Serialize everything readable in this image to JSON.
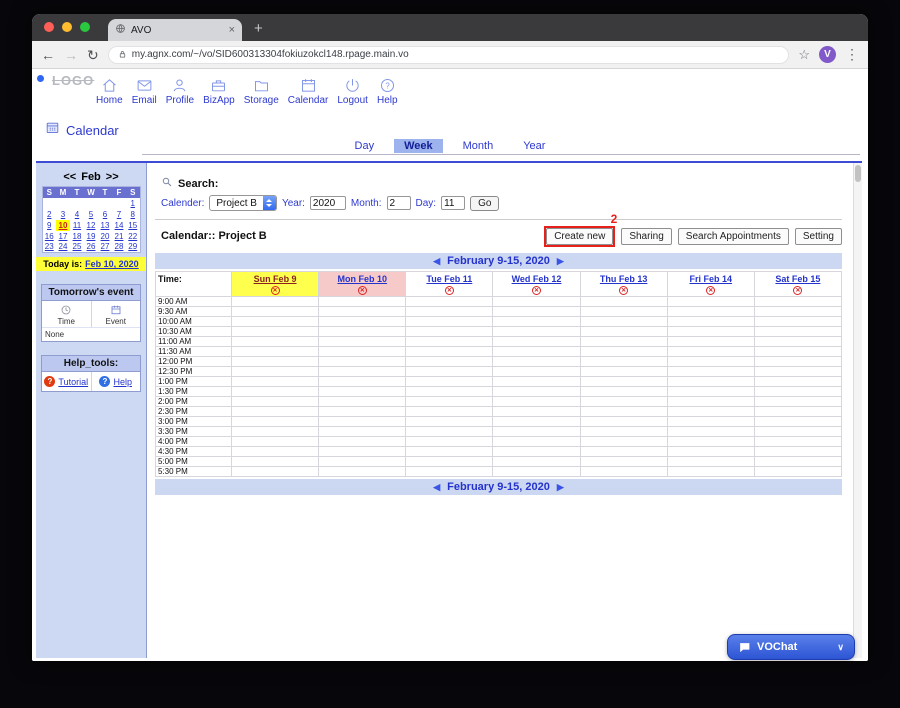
{
  "browser": {
    "tab_title": "AVO",
    "url": "my.agnx.com/~/vo/SID600313304fokiuzokcl148.rpage.main.vo",
    "avatar": "V"
  },
  "icons": {
    "back": "←",
    "forward": "→",
    "reload": "↻",
    "star": "☆",
    "menu": "⋮",
    "tab_close": "×",
    "new_tab": "+",
    "chevron_down": "∨",
    "nav_prev": "◀",
    "nav_next": "▶",
    "delete_x": "✕",
    "question": "?"
  },
  "header": {
    "logo": "LOGO",
    "nav": [
      {
        "label": "Home",
        "icon": "home-icon"
      },
      {
        "label": "Email",
        "icon": "email-icon"
      },
      {
        "label": "Profile",
        "icon": "profile-icon"
      },
      {
        "label": "BizApp",
        "icon": "bizapp-icon"
      },
      {
        "label": "Storage",
        "icon": "storage-icon"
      },
      {
        "label": "Calendar",
        "icon": "calendar-icon"
      },
      {
        "label": "Logout",
        "icon": "logout-icon"
      },
      {
        "label": "Help",
        "icon": "help-icon"
      }
    ],
    "page_title": "Calendar"
  },
  "view_tabs": [
    {
      "label": "Day",
      "active": false
    },
    {
      "label": "Week",
      "active": true
    },
    {
      "label": "Month",
      "active": false
    },
    {
      "label": "Year",
      "active": false
    }
  ],
  "sidebar": {
    "mini_calendar": {
      "prev": "<<",
      "month": "Feb",
      "next": ">>",
      "day_headers": [
        "S",
        "M",
        "T",
        "W",
        "T",
        "F",
        "S"
      ],
      "weeks": [
        [
          "",
          "",
          "",
          "",
          "",
          "",
          "1"
        ],
        [
          "2",
          "3",
          "4",
          "5",
          "6",
          "7",
          "8"
        ],
        [
          "9",
          "10",
          "11",
          "12",
          "13",
          "14",
          "15"
        ],
        [
          "16",
          "17",
          "18",
          "19",
          "20",
          "21",
          "22"
        ],
        [
          "23",
          "24",
          "25",
          "26",
          "27",
          "28",
          "29"
        ]
      ],
      "today": "10"
    },
    "today_label": "Today is:",
    "today_date": "Feb 10, 2020",
    "tomorrow": {
      "title": "Tomorrow's event",
      "col1": "Time",
      "col2": "Event",
      "value": "None"
    },
    "help_tools": {
      "title": "Help_tools:",
      "tutorial": "Tutorial",
      "help": "Help"
    }
  },
  "search": {
    "title": "Search:",
    "calender_label": "Calender:",
    "calender_value": "Project B",
    "year_label": "Year:",
    "year_value": "2020",
    "month_label": "Month:",
    "month_value": "2",
    "day_label": "Day:",
    "day_value": "11",
    "go": "Go"
  },
  "toolbar": {
    "calendar_title": "Calendar:: Project B",
    "buttons": [
      "Create new",
      "Sharing",
      "Search Appointments",
      "Setting"
    ],
    "annotation": "2"
  },
  "week": {
    "nav_label": "February 9-15, 2020",
    "time_header": "Time:",
    "days": [
      {
        "label": "Sun Feb 9",
        "bg": "#ffff4d",
        "color": "#8a2020"
      },
      {
        "label": "Mon Feb 10",
        "bg": "#f7caca",
        "color": "#2433cc"
      },
      {
        "label": "Tue Feb 11",
        "bg": "",
        "color": "#2433cc"
      },
      {
        "label": "Wed Feb 12",
        "bg": "",
        "color": "#2433cc"
      },
      {
        "label": "Thu Feb 13",
        "bg": "",
        "color": "#2433cc"
      },
      {
        "label": "Fri Feb 14",
        "bg": "",
        "color": "#2433cc"
      },
      {
        "label": "Sat Feb 15",
        "bg": "",
        "color": "#2433cc"
      }
    ],
    "times": [
      "9:00 AM",
      "9:30 AM",
      "10:00 AM",
      "10:30 AM",
      "11:00 AM",
      "11:30 AM",
      "12:00 PM",
      "12:30 PM",
      "1:00 PM",
      "1:30 PM",
      "2:00 PM",
      "2:30 PM",
      "3:00 PM",
      "3:30 PM",
      "4:00 PM",
      "4:30 PM",
      "5:00 PM",
      "5:30 PM"
    ]
  },
  "chat": {
    "label": "VOChat"
  },
  "colors": {
    "accent_blue": "#2d39cf",
    "sidebar_bg": "#cdd8f3",
    "bar_bg": "#ccd7f2",
    "highlight_yellow": "#ffff4d",
    "highlight_pink": "#f7caca",
    "annotation_red": "#e8201c",
    "chat_blue": "#2d55d4"
  }
}
